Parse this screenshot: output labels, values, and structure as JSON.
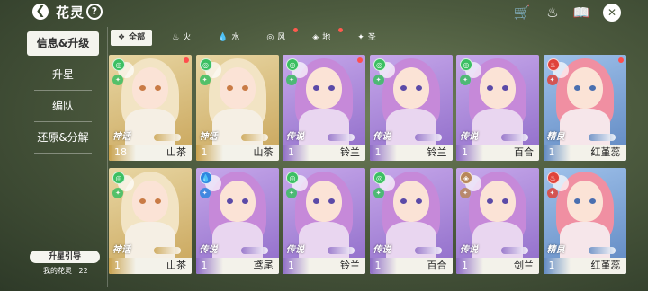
{
  "header": {
    "back_icon": "back-arrow-icon",
    "title": "花灵",
    "help_label": "?"
  },
  "top_actions": [
    {
      "name": "shop-cart-icon",
      "glyph": "🛒"
    },
    {
      "name": "fire-drop-icon",
      "glyph": "♨"
    },
    {
      "name": "book-icon",
      "glyph": "📖"
    },
    {
      "name": "close-icon",
      "glyph": "✕"
    }
  ],
  "sidebar": {
    "items": [
      {
        "label": "信息&升级",
        "active": true
      },
      {
        "label": "升星",
        "active": false
      },
      {
        "label": "编队",
        "active": false
      },
      {
        "label": "还原&分解",
        "active": false
      }
    ],
    "guide_label": "升星引导",
    "count_label": "我的花灵",
    "count_value": "22"
  },
  "tabs": [
    {
      "label": "全部",
      "glyph": "❖",
      "active": true,
      "dot": false
    },
    {
      "label": "火",
      "glyph": "♨",
      "active": false,
      "dot": false
    },
    {
      "label": "水",
      "glyph": "💧",
      "active": false,
      "dot": false
    },
    {
      "label": "风",
      "glyph": "◎",
      "active": false,
      "dot": true
    },
    {
      "label": "地",
      "glyph": "◈",
      "active": false,
      "dot": true
    },
    {
      "label": "圣",
      "glyph": "✦",
      "active": false,
      "dot": false
    }
  ],
  "cards": [
    {
      "name": "山茶",
      "level": "18",
      "rarity": "神话",
      "element": "wind",
      "theme": "gold",
      "reddot": true
    },
    {
      "name": "山茶",
      "level": "1",
      "rarity": "神话",
      "element": "wind",
      "theme": "gold",
      "reddot": false
    },
    {
      "name": "铃兰",
      "level": "1",
      "rarity": "传说",
      "element": "wind",
      "theme": "purple",
      "reddot": true
    },
    {
      "name": "铃兰",
      "level": "1",
      "rarity": "传说",
      "element": "wind",
      "theme": "purple",
      "reddot": false
    },
    {
      "name": "百合",
      "level": "1",
      "rarity": "传说",
      "element": "wind",
      "theme": "purple",
      "reddot": false
    },
    {
      "name": "红堇蕊",
      "level": "1",
      "rarity": "精良",
      "element": "fire",
      "theme": "blue",
      "reddot": true
    },
    {
      "name": "山茶",
      "level": "1",
      "rarity": "神话",
      "element": "wind",
      "theme": "gold",
      "reddot": false
    },
    {
      "name": "鸢尾",
      "level": "1",
      "rarity": "传说",
      "element": "water",
      "theme": "purple",
      "reddot": false
    },
    {
      "name": "铃兰",
      "level": "1",
      "rarity": "传说",
      "element": "wind",
      "theme": "purple",
      "reddot": false
    },
    {
      "name": "百合",
      "level": "1",
      "rarity": "传说",
      "element": "wind",
      "theme": "purple",
      "reddot": false
    },
    {
      "name": "剑兰",
      "level": "1",
      "rarity": "传说",
      "element": "earth",
      "theme": "purple",
      "reddot": false
    },
    {
      "name": "红堇蕊",
      "level": "1",
      "rarity": "精良",
      "element": "fire",
      "theme": "blue",
      "reddot": false
    }
  ],
  "colors": {
    "gold_bg": "#cdb06a",
    "purple_bg": "#9b7fd0",
    "blue_bg": "#6a95c9",
    "wind": "#3bbf62",
    "fire": "#e0433a",
    "water": "#2f86e0",
    "earth": "#b8875a",
    "reddot": "#ff4d4d"
  }
}
